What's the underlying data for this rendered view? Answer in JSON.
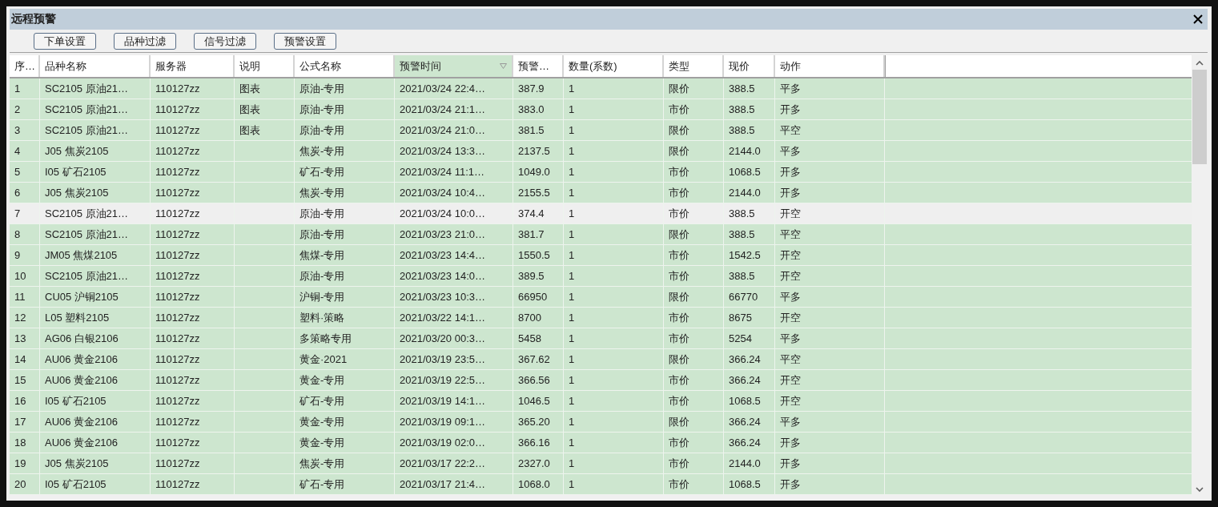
{
  "window": {
    "title": "远程预警"
  },
  "toolbar": [
    "下单设置",
    "品种过滤",
    "信号过滤",
    "预警设置"
  ],
  "table": {
    "columns": [
      {
        "label": "序…",
        "sorted": false
      },
      {
        "label": "品种名称",
        "sorted": false
      },
      {
        "label": "服务器",
        "sorted": false
      },
      {
        "label": "说明",
        "sorted": false
      },
      {
        "label": "公式名称",
        "sorted": false
      },
      {
        "label": "预警时间",
        "sorted": true
      },
      {
        "label": "预警…",
        "sorted": false
      },
      {
        "label": "数量(系数)",
        "sorted": false
      },
      {
        "label": "类型",
        "sorted": false
      },
      {
        "label": "现价",
        "sorted": false
      },
      {
        "label": "动作",
        "sorted": false
      }
    ],
    "rows": [
      {
        "selected": false,
        "cells": [
          "1",
          "SC2105 原油21…",
          "110127zz",
          "图表",
          "原油-专用",
          "2021/03/24 22:4…",
          "387.9",
          "1",
          "限价",
          "388.5",
          "平多"
        ]
      },
      {
        "selected": false,
        "cells": [
          "2",
          "SC2105 原油21…",
          "110127zz",
          "图表",
          "原油-专用",
          "2021/03/24 21:1…",
          "383.0",
          "1",
          "市价",
          "388.5",
          "开多"
        ]
      },
      {
        "selected": false,
        "cells": [
          "3",
          "SC2105 原油21…",
          "110127zz",
          "图表",
          "原油-专用",
          "2021/03/24 21:0…",
          "381.5",
          "1",
          "限价",
          "388.5",
          "平空"
        ]
      },
      {
        "selected": false,
        "cells": [
          "4",
          "J05 焦炭2105",
          "110127zz",
          null,
          "焦炭-专用",
          "2021/03/24 13:3…",
          "2137.5",
          "1",
          "限价",
          "2144.0",
          "平多"
        ]
      },
      {
        "selected": false,
        "cells": [
          "5",
          "I05 矿石2105",
          "110127zz",
          null,
          "矿石-专用",
          "2021/03/24 11:1…",
          "1049.0",
          "1",
          "市价",
          "1068.5",
          "开多"
        ]
      },
      {
        "selected": false,
        "cells": [
          "6",
          "J05 焦炭2105",
          "110127zz",
          null,
          "焦炭-专用",
          "2021/03/24 10:4…",
          "2155.5",
          "1",
          "市价",
          "2144.0",
          "开多"
        ]
      },
      {
        "selected": true,
        "cells": [
          "7",
          "SC2105 原油21…",
          "110127zz",
          null,
          "原油-专用",
          "2021/03/24 10:0…",
          "374.4",
          "1",
          "市价",
          "388.5",
          "开空"
        ]
      },
      {
        "selected": false,
        "cells": [
          "8",
          "SC2105 原油21…",
          "110127zz",
          null,
          "原油-专用",
          "2021/03/23 21:0…",
          "381.7",
          "1",
          "限价",
          "388.5",
          "平空"
        ]
      },
      {
        "selected": false,
        "cells": [
          "9",
          "JM05 焦煤2105",
          "110127zz",
          null,
          "焦煤-专用",
          "2021/03/23 14:4…",
          "1550.5",
          "1",
          "市价",
          "1542.5",
          "开空"
        ]
      },
      {
        "selected": false,
        "cells": [
          "10",
          "SC2105 原油21…",
          "110127zz",
          null,
          "原油-专用",
          "2021/03/23 14:0…",
          "389.5",
          "1",
          "市价",
          "388.5",
          "开空"
        ]
      },
      {
        "selected": false,
        "cells": [
          "11",
          "CU05 沪铜2105",
          "110127zz",
          null,
          "沪铜-专用",
          "2021/03/23 10:3…",
          "66950",
          "1",
          "限价",
          "66770",
          "平多"
        ]
      },
      {
        "selected": false,
        "cells": [
          "12",
          "L05 塑料2105",
          "110127zz",
          null,
          "塑料·策略",
          "2021/03/22 14:1…",
          "8700",
          "1",
          "市价",
          "8675",
          "开空"
        ]
      },
      {
        "selected": false,
        "cells": [
          "13",
          "AG06 白银2106",
          "110127zz",
          null,
          "多策略专用",
          "2021/03/20 00:3…",
          "5458",
          "1",
          "市价",
          "5254",
          "平多"
        ]
      },
      {
        "selected": false,
        "cells": [
          "14",
          "AU06 黄金2106",
          "110127zz",
          null,
          "黄金·2021",
          "2021/03/19 23:5…",
          "367.62",
          "1",
          "限价",
          "366.24",
          "平空"
        ]
      },
      {
        "selected": false,
        "cells": [
          "15",
          "AU06 黄金2106",
          "110127zz",
          null,
          "黄金-专用",
          "2021/03/19 22:5…",
          "366.56",
          "1",
          "市价",
          "366.24",
          "开空"
        ]
      },
      {
        "selected": false,
        "cells": [
          "16",
          "I05 矿石2105",
          "110127zz",
          null,
          "矿石-专用",
          "2021/03/19 14:1…",
          "1046.5",
          "1",
          "市价",
          "1068.5",
          "开空"
        ]
      },
      {
        "selected": false,
        "cells": [
          "17",
          "AU06 黄金2106",
          "110127zz",
          null,
          "黄金-专用",
          "2021/03/19 09:1…",
          "365.20",
          "1",
          "限价",
          "366.24",
          "平多"
        ]
      },
      {
        "selected": false,
        "cells": [
          "18",
          "AU06 黄金2106",
          "110127zz",
          null,
          "黄金-专用",
          "2021/03/19 02:0…",
          "366.16",
          "1",
          "市价",
          "366.24",
          "开多"
        ]
      },
      {
        "selected": false,
        "cells": [
          "19",
          "J05 焦炭2105",
          "110127zz",
          null,
          "焦炭-专用",
          "2021/03/17 22:2…",
          "2327.0",
          "1",
          "市价",
          "2144.0",
          "开多"
        ]
      },
      {
        "selected": false,
        "cells": [
          "20",
          "I05 矿石2105",
          "110127zz",
          null,
          "矿石-专用",
          "2021/03/17 21:4…",
          "1068.0",
          "1",
          "市价",
          "1068.5",
          "开多"
        ]
      }
    ]
  }
}
